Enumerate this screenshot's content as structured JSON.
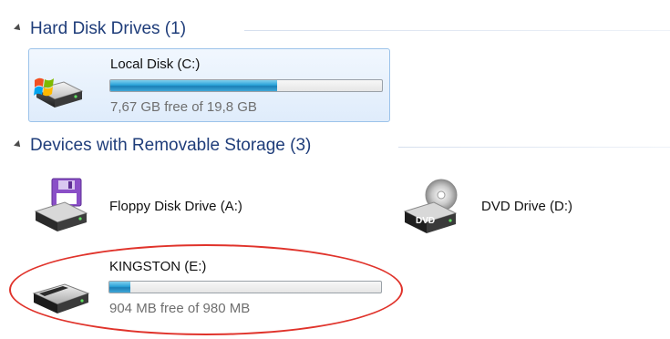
{
  "groups": {
    "hard_disk": {
      "title": "Hard Disk Drives (1)"
    },
    "removable": {
      "title": "Devices with Removable Storage (3)"
    }
  },
  "drives": {
    "local_c": {
      "name": "Local Disk (C:)",
      "free_text": "7,67 GB free of 19,8 GB",
      "used_fraction": 0.613,
      "icon": "windows-hard-disk-icon",
      "selected": true
    },
    "floppy_a": {
      "name": "Floppy Disk Drive (A:)",
      "icon": "floppy-drive-icon"
    },
    "dvd_d": {
      "name": "DVD Drive (D:)",
      "icon": "dvd-drive-icon",
      "icon_label": "DVD"
    },
    "kingston_e": {
      "name": "KINGSTON (E:)",
      "free_text": "904 MB free of 980 MB",
      "used_fraction": 0.078,
      "icon": "usb-drive-icon"
    }
  },
  "colors": {
    "group_title": "#1f3d7a",
    "usage_fill": "#2aa2d8",
    "selection_border": "#9cc3ea",
    "annotation_ellipse": "#e0332b"
  }
}
